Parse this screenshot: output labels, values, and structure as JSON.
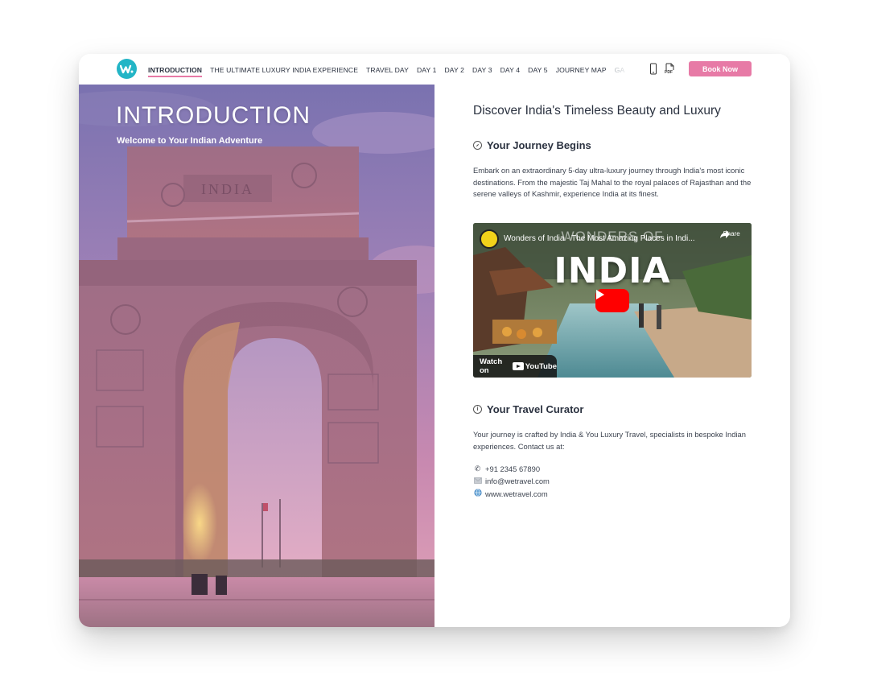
{
  "nav": {
    "items": [
      {
        "label": "INTRODUCTION",
        "active": true
      },
      {
        "label": "THE ULTIMATE LUXURY INDIA EXPERIENCE",
        "active": false
      },
      {
        "label": "TRAVEL DAY",
        "active": false
      },
      {
        "label": "DAY 1",
        "active": false
      },
      {
        "label": "DAY 2",
        "active": false
      },
      {
        "label": "DAY 3",
        "active": false
      },
      {
        "label": "DAY 4",
        "active": false
      },
      {
        "label": "DAY 5",
        "active": false
      },
      {
        "label": "JOURNEY MAP",
        "active": false
      },
      {
        "label": "GA",
        "active": false
      }
    ],
    "icons": [
      "mobile-icon",
      "pdf-icon"
    ],
    "pdf_badge": "PDF",
    "book_label": "Book Now",
    "logo_icon": "wetravel-logo-icon"
  },
  "hero": {
    "title": "INTRODUCTION",
    "subtitle": "Welcome to Your Indian Adventure",
    "monument_inscription": "INDIA"
  },
  "main": {
    "heading": "Discover India's Timeless Beauty and Luxury",
    "journey": {
      "title": "Your Journey Begins",
      "icon": "compass-icon",
      "body": "Embark on an extraordinary 5-day ultra-luxury journey through India's most iconic destinations. From the majestic Taj Mahal to the royal palaces of Rajasthan and the serene valleys of Kashmir, experience India at its finest."
    },
    "video": {
      "title": "Wonders of India - The Most Amazing Places in Indi...",
      "overlay_top": "WONDERS OF",
      "overlay_big": "INDIA",
      "share_label": "Share",
      "watch_label": "Watch on",
      "youtube_label": "YouTube"
    },
    "curator": {
      "title": "Your Travel Curator",
      "icon": "info-icon",
      "body": "Your journey is crafted by India & You Luxury Travel, specialists in bespoke Indian experiences. Contact us at:"
    },
    "contacts": {
      "phone": "+91 2345 67890",
      "email": "info@wetravel.com",
      "website": "www.wetravel.com"
    }
  },
  "colors": {
    "accent_pink": "#e77aa6",
    "logo_teal": "#23b5c6",
    "text_dark": "#2b3240"
  }
}
